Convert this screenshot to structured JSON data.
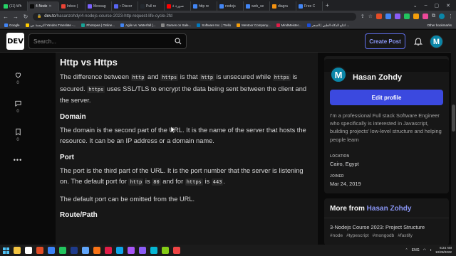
{
  "browser": {
    "tabs": [
      {
        "label": "(11) Wh",
        "color": "#25d366"
      },
      {
        "label": "4-Node",
        "color": "#0a0a0a",
        "active": true
      },
      {
        "label": "Inbox (",
        "color": "#ea4335"
      },
      {
        "label": "Messag",
        "color": "#7b61ff"
      },
      {
        "label": "• Discor",
        "color": "#5865f2"
      },
      {
        "label": "Pull re",
        "color": "#24292f"
      },
      {
        "label": "صورة ٤",
        "color": "#ff0000"
      },
      {
        "label": "http re",
        "color": "#4285f4"
      },
      {
        "label": "nodejs",
        "color": "#4285f4"
      },
      {
        "label": "web_se",
        "color": "#4285f4"
      },
      {
        "label": "diagra",
        "color": "#f29111"
      },
      {
        "label": "Free C",
        "color": "#4285f4"
      }
    ],
    "new_tab": "+",
    "window_controls": [
      "⌄",
      "–",
      "▢",
      "✕"
    ],
    "url_domain": "dev.to",
    "url_path": "/hasanzohdy/4-nodejs-course-2023-http-request-life-cycle-2fd",
    "bookmarks": [
      {
        "label": "Google",
        "color": "#4285f4"
      },
      {
        "label": "الترجمة من Yandex.Translate -...",
        "color": "#ffcc00"
      },
      {
        "label": "Photopea | Online...",
        "color": "#18a497"
      },
      {
        "label": "Agile vs. Waterfall (...",
        "color": "#4285f4"
      },
      {
        "label": "Games on Sale...",
        "color": "#888888"
      },
      {
        "label": "Software Inc. | Trello",
        "color": "#0079bf"
      },
      {
        "label": "Mentoor Company...",
        "color": "#f59e0b"
      },
      {
        "label": "MindMeister...",
        "color": "#e11d48"
      },
      {
        "label": "انتاج الذكاء الطبي | السعر ...",
        "color": "#1d4ed8"
      }
    ],
    "other_bookmarks": "Other bookmarks"
  },
  "header": {
    "logo": "DEV",
    "search_placeholder": "Search...",
    "create_post": "Create Post",
    "avatar_letter": "M"
  },
  "reactions": [
    {
      "name": "heart-icon",
      "count": "0"
    },
    {
      "name": "comment-icon",
      "count": "0"
    },
    {
      "name": "bookmark-icon",
      "count": "0"
    }
  ],
  "more_dots": "•••",
  "article": {
    "heading": "Http vs Https",
    "p1_a": "The difference between ",
    "p1_code1": "http",
    "p1_b": " and ",
    "p1_code2": "https",
    "p1_c": " is that ",
    "p1_code3": "http",
    "p1_d": " is unsecured while ",
    "p1_code4": "https",
    "p1_e": " is secured. ",
    "p1_code5": "https",
    "p1_f": " uses SSL/TLS to encrypt the data being sent between the client and the server.",
    "domain_heading": "Domain",
    "domain_text": "The domain is the second part of the URL. It is the name of the server that hosts the resource. It can be an IP address or a domain name.",
    "port_heading": "Port",
    "port_a": "The port is the third part of the URL. It is the port number that the server is listening on. The default port for ",
    "port_code1": "http",
    "port_b": " is ",
    "port_code2": "80",
    "port_c": " and for ",
    "port_code3": "https",
    "port_d": " is ",
    "port_code4": "443",
    "port_e": ".",
    "port_text2": "The default port can be omitted from the URL.",
    "route_heading": "Route/Path"
  },
  "profile": {
    "avatar_letter": "M",
    "name": "Hasan Zohdy",
    "edit_button": "Edit profile",
    "bio": "I'm a professional Full stack Software Engineer who specifically is interested in Javascript, building projects' low-level structure and helping people learn",
    "location_label": "LOCATION",
    "location": "Cairo, Egypt",
    "joined_label": "JOINED",
    "joined": "Mar 24, 2019"
  },
  "more_from": {
    "prefix": "More from ",
    "author": "Hasan Zohdy",
    "post_title": "3-Nodejs Course 2023: Project Structure",
    "tags": [
      "#node",
      "#typescript",
      "#mongodb",
      "#fastify"
    ]
  },
  "taskbar": {
    "icons": [
      "#f4c542",
      "#ffffff",
      "#e34c26",
      "#3b82f6",
      "#22c55e",
      "#1e3a8a",
      "#60a5fa",
      "#f97316",
      "#e11d48",
      "#0ea5e9",
      "#a855f7",
      "#8b5cf6",
      "#06b6d4",
      "#84cc16",
      "#ef4444"
    ],
    "lang": "ENG",
    "time": "6:24 AM",
    "date": "10/28/2022"
  },
  "colors": {
    "accent": "#3b49df",
    "background": "#0a0a0a",
    "card": "#171717"
  }
}
